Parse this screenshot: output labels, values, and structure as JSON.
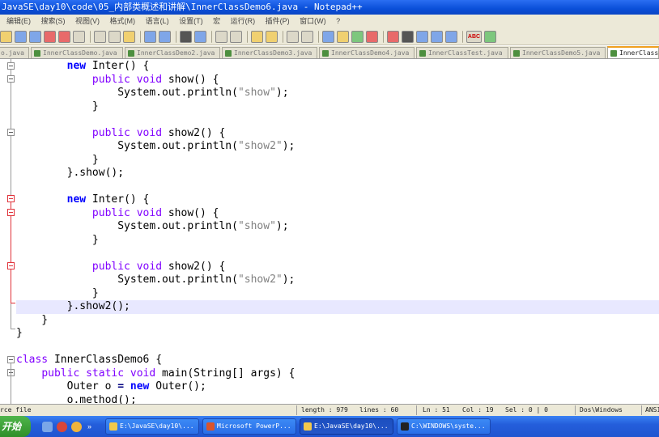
{
  "window": {
    "title": "JavaSE\\day10\\code\\05_内部类概述和讲解\\InnerClassDemo6.java - Notepad++"
  },
  "menu": {
    "items": [
      "编辑(E)",
      "搜索(S)",
      "视图(V)",
      "格式(M)",
      "语言(L)",
      "设置(T)",
      "宏",
      "运行(R)",
      "插件(P)",
      "窗口(W)",
      "?"
    ]
  },
  "toolbar": {
    "icons": [
      "open-icon",
      "save-icon",
      "save-all-icon",
      "close-icon",
      "close-all-icon",
      "print-icon",
      "cut-icon",
      "copy-icon",
      "paste-icon",
      "undo-icon",
      "redo-icon",
      "find-icon",
      "replace-icon",
      "zoom-in-icon",
      "zoom-out-icon",
      "sync-v-icon",
      "sync-h-icon",
      "wrap-icon",
      "all-chars-icon",
      "indent-guide-icon",
      "udl-icon",
      "doc-map-icon",
      "function-list-icon",
      "record-macro-icon",
      "stop-macro-icon",
      "play-macro-icon",
      "run-macro-icon",
      "save-macro-icon",
      "spellcheck-icon",
      "spellcheck-auto-icon"
    ],
    "spellcheck_label": "ABC"
  },
  "tabs": [
    {
      "label": "o.java"
    },
    {
      "label": "InnerClassDemo.java"
    },
    {
      "label": "InnerClassDemo2.java"
    },
    {
      "label": "InnerClassDemo3.java"
    },
    {
      "label": "InnerClassDemo4.java"
    },
    {
      "label": "InnerClassTest.java"
    },
    {
      "label": "InnerClassDemo5.java"
    },
    {
      "label": "InnerClass"
    }
  ],
  "code": {
    "lines": [
      [
        [
          "",
          "        "
        ],
        [
          "kw",
          "new"
        ],
        [
          "",
          " Inter() {"
        ]
      ],
      [
        [
          "",
          "            "
        ],
        [
          "kw2",
          "public"
        ],
        [
          "",
          " "
        ],
        [
          "kw2",
          "void"
        ],
        [
          "",
          " show() {"
        ]
      ],
      [
        [
          "",
          "                System.out.println("
        ],
        [
          "str",
          "\"show\""
        ],
        [
          "",
          ");"
        ]
      ],
      [
        [
          "",
          "            }"
        ]
      ],
      [
        [
          "",
          ""
        ]
      ],
      [
        [
          "",
          "            "
        ],
        [
          "kw2",
          "public"
        ],
        [
          "",
          " "
        ],
        [
          "kw2",
          "void"
        ],
        [
          "",
          " show2() {"
        ]
      ],
      [
        [
          "",
          "                System.out.println("
        ],
        [
          "str",
          "\"show2\""
        ],
        [
          "",
          ");"
        ]
      ],
      [
        [
          "",
          "            }"
        ]
      ],
      [
        [
          "",
          "        }.show();"
        ]
      ],
      [
        [
          "",
          ""
        ]
      ],
      [
        [
          "",
          "        "
        ],
        [
          "kw",
          "new"
        ],
        [
          "",
          " Inter() {"
        ]
      ],
      [
        [
          "",
          "            "
        ],
        [
          "kw2",
          "public"
        ],
        [
          "",
          " "
        ],
        [
          "kw2",
          "void"
        ],
        [
          "",
          " show() {"
        ]
      ],
      [
        [
          "",
          "                System.out.println("
        ],
        [
          "str",
          "\"show\""
        ],
        [
          "",
          ");"
        ]
      ],
      [
        [
          "",
          "            }"
        ]
      ],
      [
        [
          "",
          ""
        ]
      ],
      [
        [
          "",
          "            "
        ],
        [
          "kw2",
          "public"
        ],
        [
          "",
          " "
        ],
        [
          "kw2",
          "void"
        ],
        [
          "",
          " show2() {"
        ]
      ],
      [
        [
          "",
          "                System.out.println("
        ],
        [
          "str",
          "\"show2\""
        ],
        [
          "",
          ");"
        ]
      ],
      [
        [
          "",
          "            }"
        ]
      ],
      [
        [
          "",
          "        }.show2();"
        ]
      ],
      [
        [
          "",
          "    }"
        ]
      ],
      [
        [
          "",
          "}"
        ]
      ],
      [
        [
          "",
          ""
        ]
      ],
      [
        [
          "kw2",
          "class"
        ],
        [
          "",
          " InnerClassDemo6 {"
        ]
      ],
      [
        [
          "",
          "    "
        ],
        [
          "kw2",
          "public"
        ],
        [
          "",
          " "
        ],
        [
          "kw2",
          "static"
        ],
        [
          "",
          " "
        ],
        [
          "kw2",
          "void"
        ],
        [
          "",
          " main(String[] args) {"
        ]
      ],
      [
        [
          "",
          "        Outer o "
        ],
        [
          "op",
          "="
        ],
        [
          "",
          " "
        ],
        [
          "kw",
          "new"
        ],
        [
          "",
          " Outer();"
        ]
      ],
      [
        [
          "",
          "        o.method();"
        ]
      ]
    ],
    "current_line_index": 18
  },
  "status": {
    "file_type": "rce file",
    "length": "length : 979",
    "lines": "lines : 60",
    "ln": "Ln : 51",
    "col": "Col : 19",
    "sel": "Sel : 0 | 0",
    "eol": "Dos\\Windows",
    "encoding": "ANSI"
  },
  "taskbar": {
    "start_label": "开始",
    "buttons": [
      {
        "label": "E:\\JavaSE\\day10\\...",
        "color": "#f2c94c"
      },
      {
        "label": "Microsoft PowerP...",
        "color": "#d9542c"
      },
      {
        "label": "E:\\JavaSE\\day10\\...",
        "color": "#f2c94c"
      },
      {
        "label": "C:\\WINDOWS\\syste...",
        "color": "#222222"
      }
    ]
  }
}
